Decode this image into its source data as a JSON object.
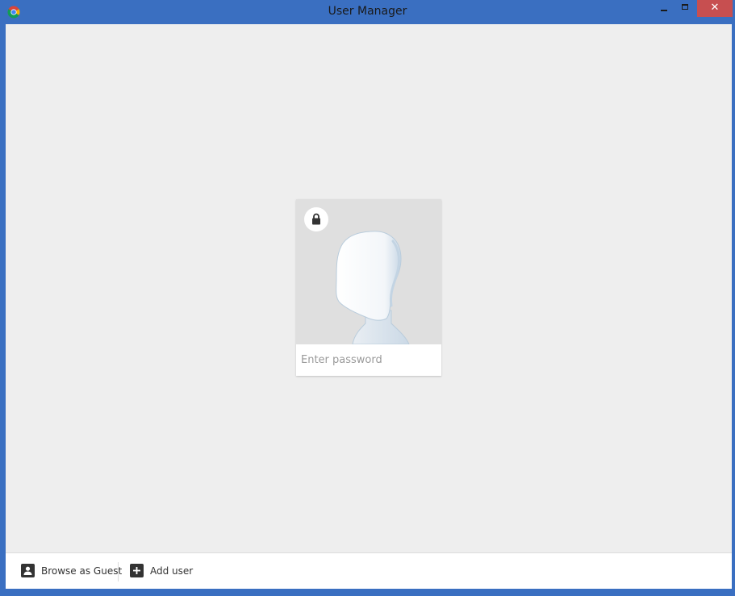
{
  "window": {
    "title": "User Manager",
    "icon": "chrome-logo-icon",
    "controls": {
      "minimize_icon": "minimize-icon",
      "maximize_icon": "maximize-icon",
      "close_icon": "close-icon",
      "close_glyph": "✕"
    },
    "frame_color": "#3a6fc1",
    "close_color": "#c74f50"
  },
  "profile_card": {
    "avatar_icon": "generic-avatar-icon",
    "lock_icon": "lock-icon",
    "password_placeholder": "Enter password",
    "password_value": ""
  },
  "footer": {
    "guest_button": {
      "label": "Browse as Guest",
      "icon": "person-icon"
    },
    "add_user_button": {
      "label": "Add user",
      "icon": "plus-icon"
    }
  },
  "colors": {
    "background": "#eeeeee",
    "card_avatar_bg": "#dfdfdf",
    "text_dark": "#333333"
  }
}
